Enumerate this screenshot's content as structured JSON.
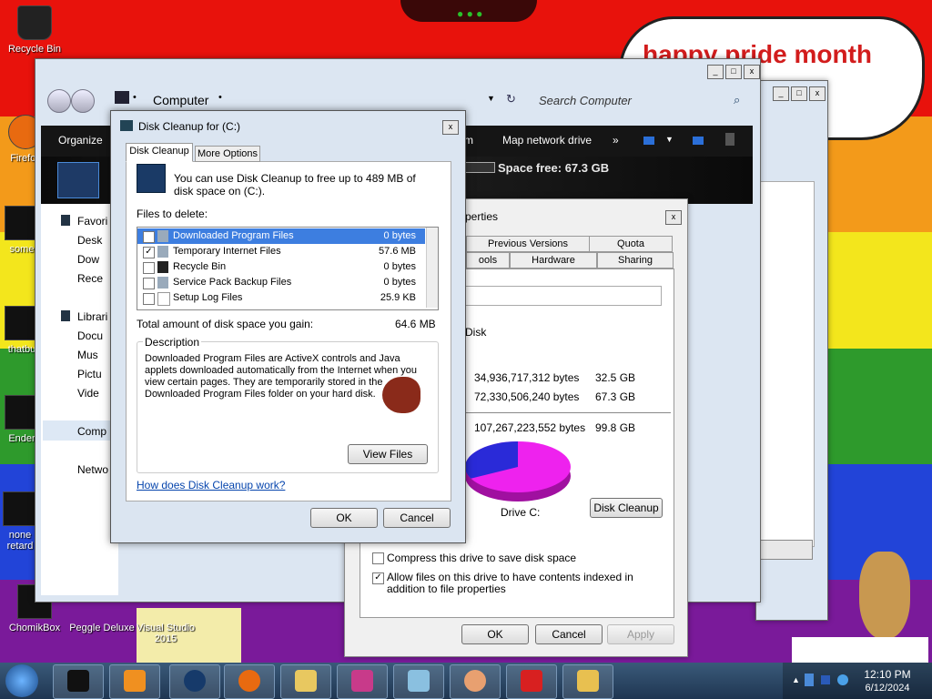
{
  "wallpaper": {
    "bubble_text": "happy pride month"
  },
  "desktop_icons": [
    {
      "label": "Recycle Bin",
      "icon": "recycle-bin-icon"
    },
    {
      "label": "Firefox",
      "icon": "firefox-icon"
    },
    {
      "label": "some",
      "icon": "file-icon"
    },
    {
      "label": "thatbu",
      "icon": "file-icon"
    },
    {
      "label": "Ender",
      "icon": "file-icon"
    },
    {
      "label": "none retard",
      "icon": "file-icon"
    },
    {
      "label": "ChomikBox",
      "icon": "chomikbox-icon"
    },
    {
      "label": "Peggle Deluxe",
      "icon": "peggle-icon"
    },
    {
      "label": "Visual Studio 2015",
      "icon": "visual-studio-icon"
    }
  ],
  "explorer": {
    "address_text": "Computer",
    "search_placeholder": "Search Computer",
    "toolbar": {
      "organize": "Organize",
      "map_drive": "Map network drive",
      "more": "»",
      "partial_m": "m"
    },
    "space_free": "Space free: 67.3 GB",
    "nav": [
      "Favori",
      "Desk",
      "Dow",
      "Rece",
      "Librari",
      "Docu",
      "Mus",
      "Pictu",
      "Vide",
      "Comp",
      "Netwo"
    ]
  },
  "properties": {
    "title_partial": "perties",
    "tabs_row1": [
      "Previous Versions",
      "Quota"
    ],
    "tabs_row2": [
      "ools",
      "Hardware",
      "Sharing"
    ],
    "type_label": "Disk",
    "used_bytes": "34,936,717,312 bytes",
    "used_gb": "32.5 GB",
    "free_bytes": "72,330,506,240 bytes",
    "free_gb": "67.3 GB",
    "capacity_bytes": "107,267,223,552 bytes",
    "capacity_gb": "99.8 GB",
    "drive_label": "Drive C:",
    "disk_cleanup_button": "Disk Cleanup",
    "compress_label": "Compress this drive to save disk space",
    "index_label": "Allow files on this drive to have contents indexed in addition to file properties",
    "ok": "OK",
    "cancel": "Cancel",
    "apply": "Apply",
    "pie": {
      "used_fraction": 0.325,
      "used_color": "#2a2ad8",
      "free_color": "#ee22ee"
    }
  },
  "disk_cleanup": {
    "title": "Disk Cleanup for  (C:)",
    "tab_cleanup": "Disk Cleanup",
    "tab_more": "More Options",
    "intro": "You can use Disk Cleanup to free up to 489 MB of disk space on  (C:).",
    "files_to_delete": "Files to delete:",
    "files": [
      {
        "name": "Downloaded Program Files",
        "size": "0 bytes",
        "checked": true,
        "selected": true
      },
      {
        "name": "Temporary Internet Files",
        "size": "57.6 MB",
        "checked": true,
        "selected": false
      },
      {
        "name": "Recycle Bin",
        "size": "0 bytes",
        "checked": false,
        "selected": false
      },
      {
        "name": "Service Pack Backup Files",
        "size": "0 bytes",
        "checked": false,
        "selected": false
      },
      {
        "name": "Setup Log Files",
        "size": "25.9 KB",
        "checked": false,
        "selected": false
      }
    ],
    "total_label": "Total amount of disk space you gain:",
    "total_value": "64.6 MB",
    "description_label": "Description",
    "description_text": "Downloaded Program Files are ActiveX controls and Java applets downloaded automatically from the Internet when you view certain pages. They are temporarily stored in the Downloaded Program Files folder on your hard disk.",
    "view_files": "View Files",
    "help_link": "How does Disk Cleanup work?",
    "ok": "OK",
    "cancel": "Cancel"
  },
  "taskbar": {
    "apps": [
      "start-orb-icon",
      "disk-icon",
      "media-player-icon",
      "globe-icon",
      "firefox-icon",
      "explorer-folder-icon",
      "display-icon",
      "notepad-icon",
      "user-icon",
      "game-icon",
      "folder-tools-icon"
    ],
    "time": "12:10 PM",
    "date": "6/12/2024"
  }
}
